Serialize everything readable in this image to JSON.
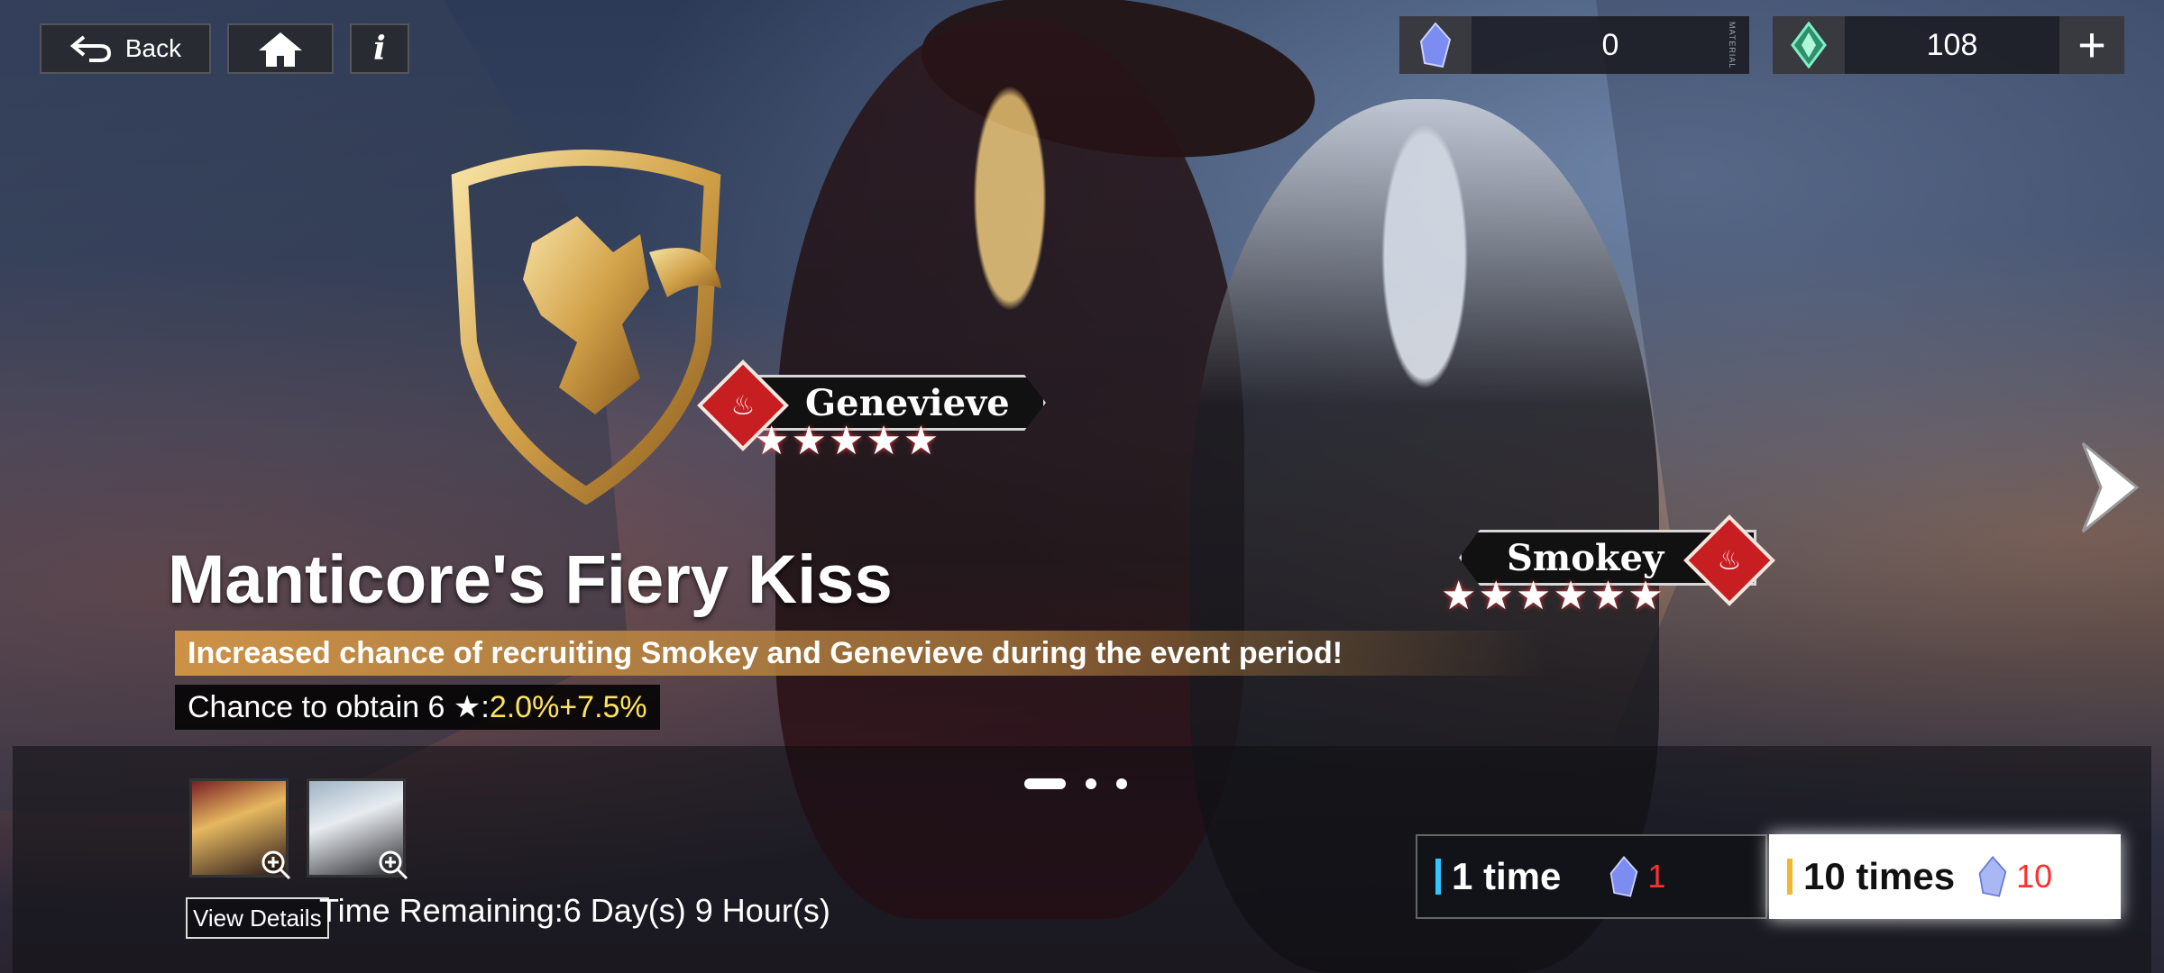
{
  "topbar": {
    "back_label": "Back",
    "info_label": "i"
  },
  "currencies": {
    "material": {
      "value": "0",
      "tag": "MATERIAL",
      "icon": "crystal-shard-icon",
      "color": "#6f7fe6"
    },
    "gem": {
      "value": "108",
      "icon": "green-gem-icon",
      "color": "#3fd69a",
      "plus": "+"
    }
  },
  "characters": {
    "genevieve": {
      "name": "Genevieve",
      "stars": "★★★★★",
      "element": "fire"
    },
    "smokey": {
      "name": "Smokey",
      "stars": "★★★★★★",
      "element": "fire"
    }
  },
  "banner": {
    "title": "Manticore's Fiery Kiss",
    "subtitle": "Increased chance of recruiting Smokey and Genevieve during the event period!",
    "chance_label": "Chance to obtain 6 ★:",
    "chance_rate": "2.0%+7.5%"
  },
  "bottom": {
    "view_details": "View Details",
    "time_remaining": "Time Remaining:6 Day(s) 9 Hour(s)",
    "pull_one": {
      "label": "1 time",
      "cost": "1"
    },
    "pull_ten": {
      "label": "10 times",
      "cost": "10"
    }
  },
  "pagination": {
    "current": 1,
    "total": 3
  }
}
